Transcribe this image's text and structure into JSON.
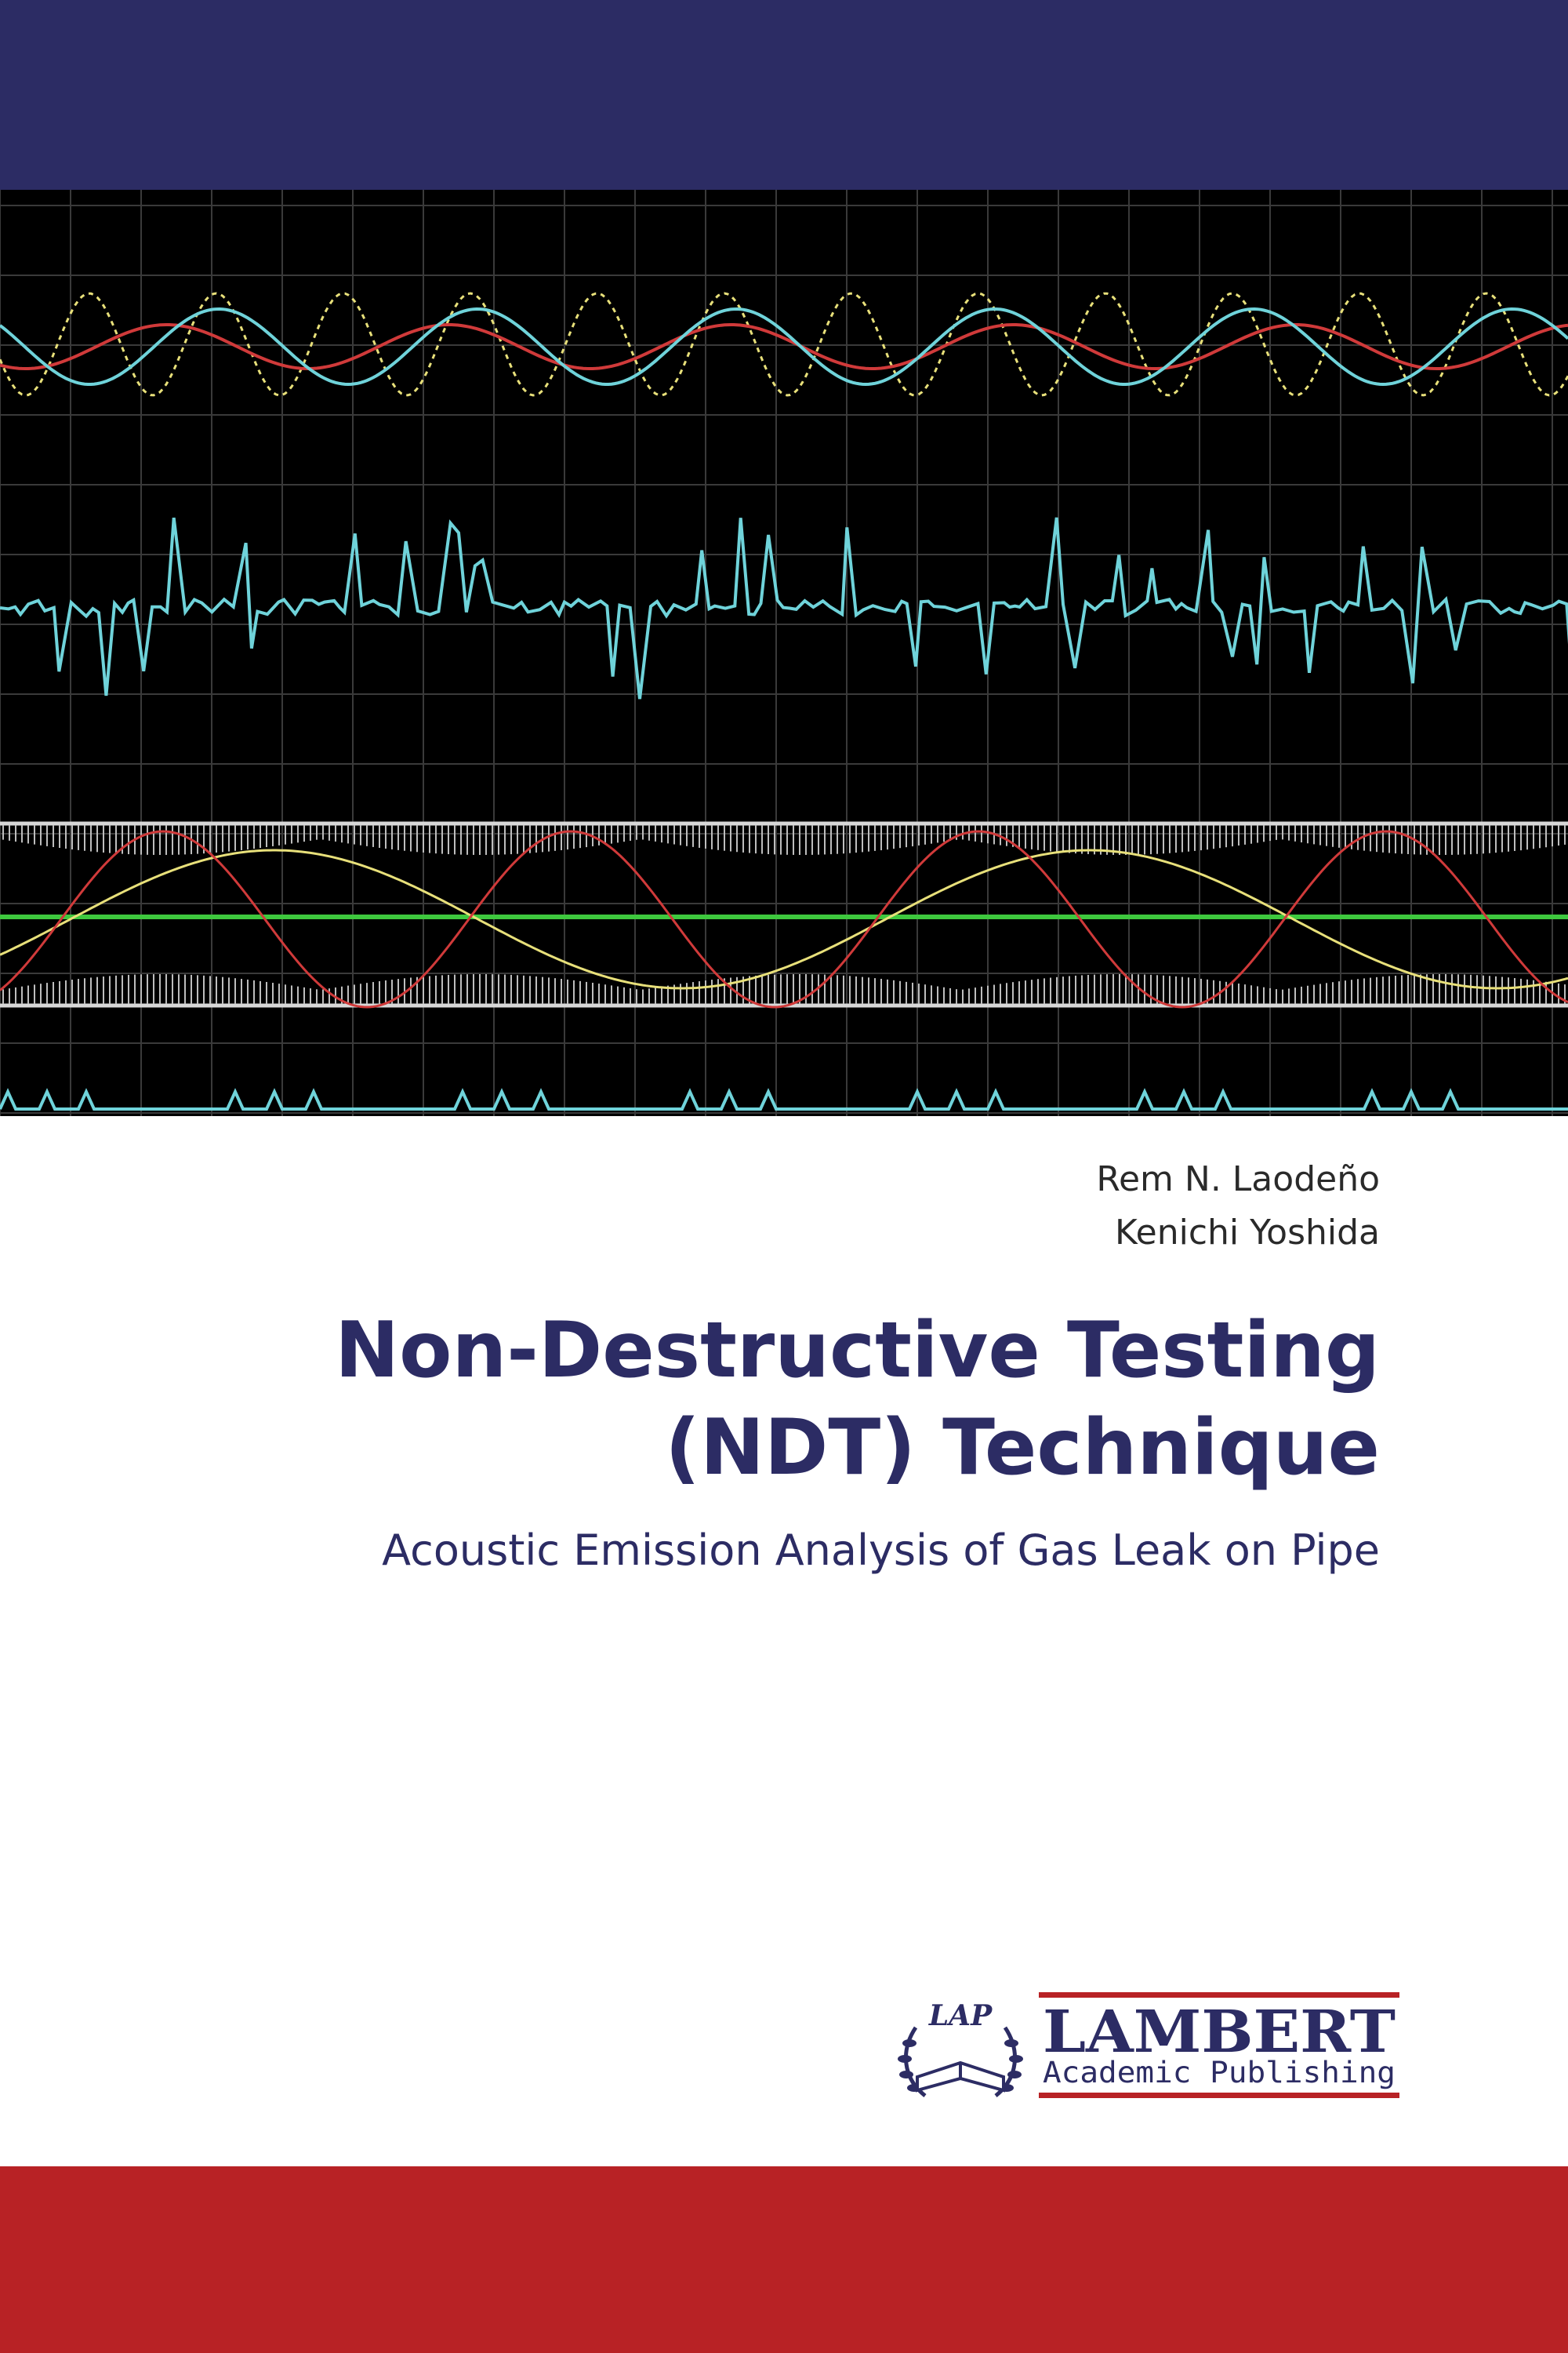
{
  "colors": {
    "navy": "#2c2c64",
    "red": "#b82225",
    "scope_bg": "#000000",
    "grid": "#3a3a3a",
    "cyan": "#6fd3da",
    "trace_red": "#d03a3a",
    "yellow": "#e8e07a",
    "green": "#3ec83e"
  },
  "cover": {
    "authors": [
      "Rem N. Laodeño",
      "Kenichi Yoshida"
    ],
    "title_line1": "Non-Destructive Testing",
    "title_line2": "(NDT) Technique",
    "subtitle": "Acoustic Emission Analysis of Gas Leak on Pipe"
  },
  "publisher": {
    "emblem": "LAP",
    "name": "LAMBERT",
    "tagline": "Academic Publishing"
  },
  "icons": {
    "emblem": "open-book-laurel-icon"
  }
}
